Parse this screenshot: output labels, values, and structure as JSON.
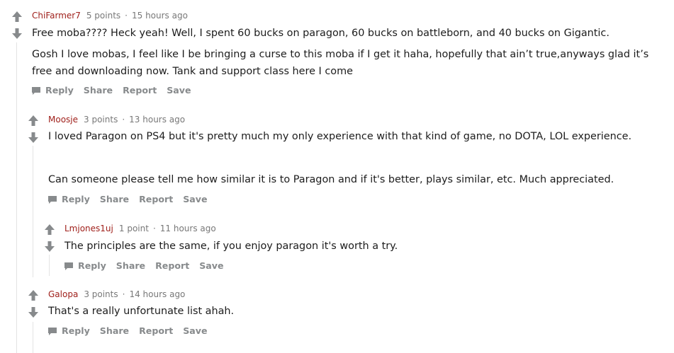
{
  "colors": {
    "author": "#a0211c",
    "meta": "#787878",
    "arrow": "#878a8c",
    "action": "#878a8c",
    "thread_line": "#e3e3e3"
  },
  "icons": {
    "upvote": "arrow-up-icon",
    "downvote": "arrow-down-icon",
    "reply": "speech-bubble-icon"
  },
  "comments": [
    {
      "author": "ChiFarmer7",
      "points": "5 points",
      "separator": "·",
      "time": "15 hours ago",
      "paragraphs": [
        "Free moba???? Heck yeah! Well, I spent 60 bucks on paragon, 60 bucks on battleborn, and 40 bucks on Gigantic.",
        "Gosh I love mobas, I feel like I be bringing a curse to this moba if I get it haha, hopefully that ain’t true,anyways glad it’s free and downloading now. Tank and support class here I come"
      ],
      "actions": {
        "reply": "Reply",
        "share": "Share",
        "report": "Report",
        "save": "Save"
      }
    },
    {
      "author": "Moosje",
      "points": "3 points",
      "separator": "·",
      "time": "13 hours ago",
      "paragraphs": [
        "I loved Paragon on PS4 but it's pretty much my only experience with that kind of game, no DOTA, LOL experience.",
        "Can someone please tell me how similar it is to Paragon and if it's better, plays similar, etc. Much appreciated."
      ],
      "actions": {
        "reply": "Reply",
        "share": "Share",
        "report": "Report",
        "save": "Save"
      }
    },
    {
      "author": "Lmjones1uj",
      "points": "1 point",
      "separator": "·",
      "time": "11 hours ago",
      "paragraphs": [
        "The principles are the same, if you enjoy paragon it's worth a try."
      ],
      "actions": {
        "reply": "Reply",
        "share": "Share",
        "report": "Report",
        "save": "Save"
      }
    },
    {
      "author": "Galopa",
      "points": "3 points",
      "separator": "·",
      "time": "14 hours ago",
      "paragraphs": [
        "That's a really unfortunate list ahah."
      ],
      "actions": {
        "reply": "Reply",
        "share": "Share",
        "report": "Report",
        "save": "Save"
      }
    }
  ]
}
